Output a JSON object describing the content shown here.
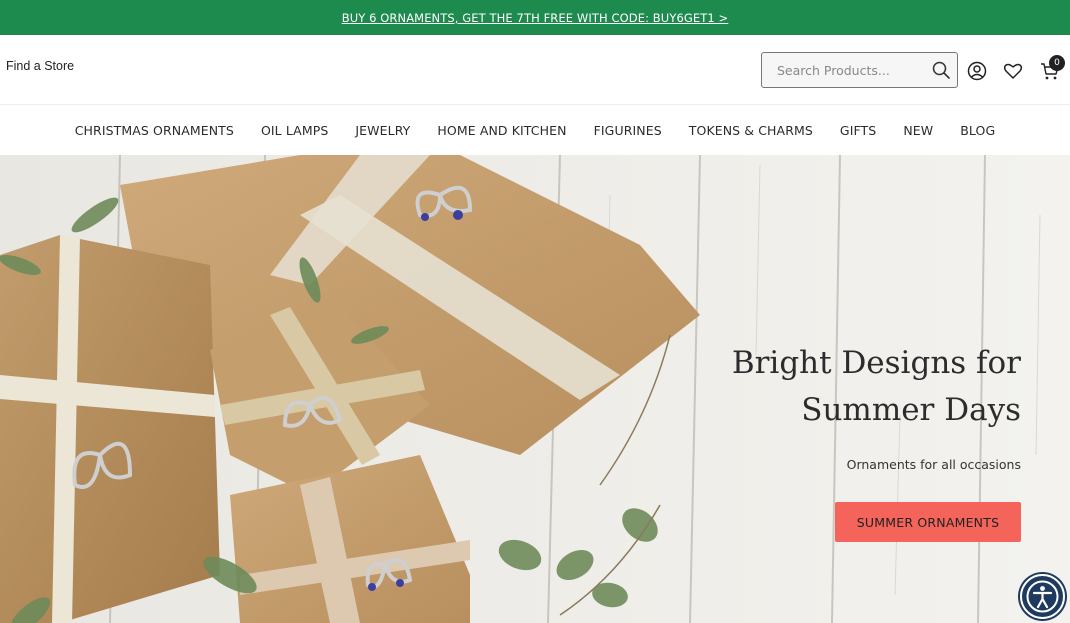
{
  "promo": {
    "text": "BUY 6 ORNAMENTS, GET THE 7TH FREE WITH CODE: BUY6GET1 >"
  },
  "header": {
    "find_store": "Find a Store",
    "search_placeholder": "Search Products...",
    "cart_count": "0"
  },
  "nav": {
    "items": [
      "CHRISTMAS ORNAMENTS",
      "OIL LAMPS",
      "JEWELRY",
      "HOME AND KITCHEN",
      "FIGURINES",
      "TOKENS & CHARMS",
      "GIFTS",
      "NEW",
      "BLOG"
    ]
  },
  "hero": {
    "headline_line1": "Bright Designs for",
    "headline_line2": "Summer Days",
    "subline": "Ornaments for all occasions",
    "cta_label": "SUMMER ORNAMENTS"
  },
  "colors": {
    "promo_bg": "#1d8a4e",
    "cta_bg": "#f4645a",
    "accessibility_bg": "#1e3a5f"
  },
  "icons": [
    "search-icon",
    "account-icon",
    "heart-icon",
    "cart-icon",
    "accessibility-icon"
  ]
}
